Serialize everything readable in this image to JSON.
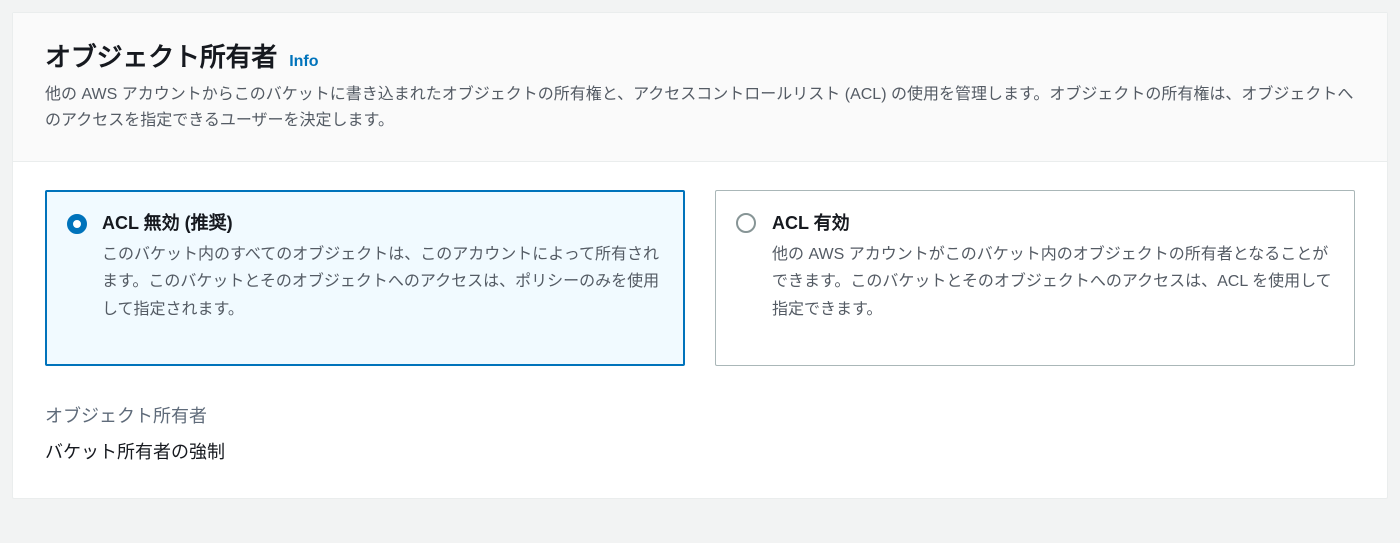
{
  "header": {
    "title": "オブジェクト所有者",
    "info_label": "Info",
    "description": "他の AWS アカウントからこのバケットに書き込まれたオブジェクトの所有権と、アクセスコントロールリスト (ACL) の使用を管理します。オブジェクトの所有権は、オブジェクトへのアクセスを指定できるユーザーを決定します。"
  },
  "options": {
    "disabled": {
      "label": "ACL 無効 (推奨)",
      "description": "このバケット内のすべてのオブジェクトは、このアカウントによって所有されます。このバケットとそのオブジェクトへのアクセスは、ポリシーのみを使用して指定されます。",
      "selected": true
    },
    "enabled": {
      "label": "ACL 有効",
      "description": "他の AWS アカウントがこのバケット内のオブジェクトの所有者となることができます。このバケットとそのオブジェクトへのアクセスは、ACL を使用して指定できます。",
      "selected": false
    }
  },
  "footer": {
    "label": "オブジェクト所有者",
    "value": "バケット所有者の強制"
  }
}
